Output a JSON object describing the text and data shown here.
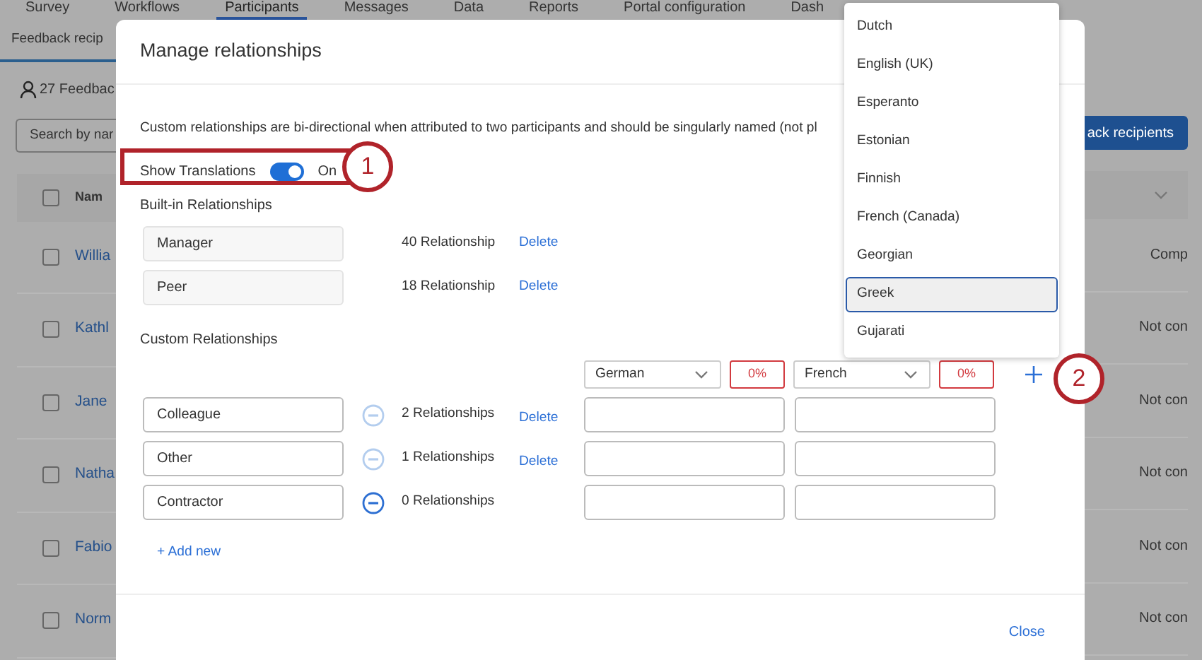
{
  "nav_tabs": [
    {
      "label": "Survey",
      "selected": false
    },
    {
      "label": "Workflows",
      "selected": false
    },
    {
      "label": "Participants",
      "selected": true
    },
    {
      "label": "Messages",
      "selected": false
    },
    {
      "label": "Data",
      "selected": false
    },
    {
      "label": "Reports",
      "selected": false
    },
    {
      "label": "Portal configuration",
      "selected": false
    },
    {
      "label": "Dash",
      "selected": false
    }
  ],
  "sub_tab": {
    "label": "Feedback recip",
    "selected": true
  },
  "count": "27 Feedbac",
  "search": {
    "placeholder": "Search by nar"
  },
  "add_button": "ack recipients",
  "table": {
    "columns": [
      "Nam"
    ],
    "select_all": {
      "checked": false
    },
    "rows": [
      {
        "checked": false,
        "name": "Willia",
        "status": "Comp"
      },
      {
        "checked": false,
        "name": "Kathl",
        "status": "Not con"
      },
      {
        "checked": false,
        "name": "Jane",
        "status": "Not con"
      },
      {
        "checked": false,
        "name": "Natha",
        "status": "Not con"
      },
      {
        "checked": false,
        "name": "Fabio",
        "status": "Not con"
      },
      {
        "checked": false,
        "name": "Norm",
        "status": "Not con"
      }
    ]
  },
  "modal": {
    "title": "Manage relationships",
    "description": "Custom relationships are bi-directional when attributed to two participants and should be singularly named (not pl",
    "translations_toggle": {
      "label": "Show Translations",
      "on": true,
      "state_text": "On"
    },
    "builtin_heading": "Built-in Relationships",
    "builtin": [
      {
        "name": "Manager",
        "count": "40 Relationship",
        "action": "Delete"
      },
      {
        "name": "Peer",
        "count": "18 Relationship",
        "action": "Delete"
      }
    ],
    "custom_heading": "Custom Relationships",
    "languages": [
      {
        "value": "German",
        "progress": "0%"
      },
      {
        "value": "French",
        "progress": "0%"
      }
    ],
    "custom": [
      {
        "name": "Colleague",
        "remove_enabled": false,
        "count": "2 Relationships",
        "action": "Delete"
      },
      {
        "name": "Other",
        "remove_enabled": false,
        "count": "1 Relationships",
        "action": "Delete"
      },
      {
        "name": "Contractor",
        "remove_enabled": true,
        "count": "0 Relationships"
      }
    ],
    "add_new": "+ Add new",
    "close": "Close"
  },
  "language_menu": [
    {
      "label": "Dutch",
      "selected": false
    },
    {
      "label": "English (UK)",
      "selected": false
    },
    {
      "label": "Esperanto",
      "selected": false
    },
    {
      "label": "Estonian",
      "selected": false
    },
    {
      "label": "Finnish",
      "selected": false
    },
    {
      "label": "French (Canada)",
      "selected": false
    },
    {
      "label": "Georgian",
      "selected": false
    },
    {
      "label": "Greek",
      "selected": true
    },
    {
      "label": "Gujarati",
      "selected": false
    }
  ],
  "callouts": [
    "1",
    "2"
  ]
}
